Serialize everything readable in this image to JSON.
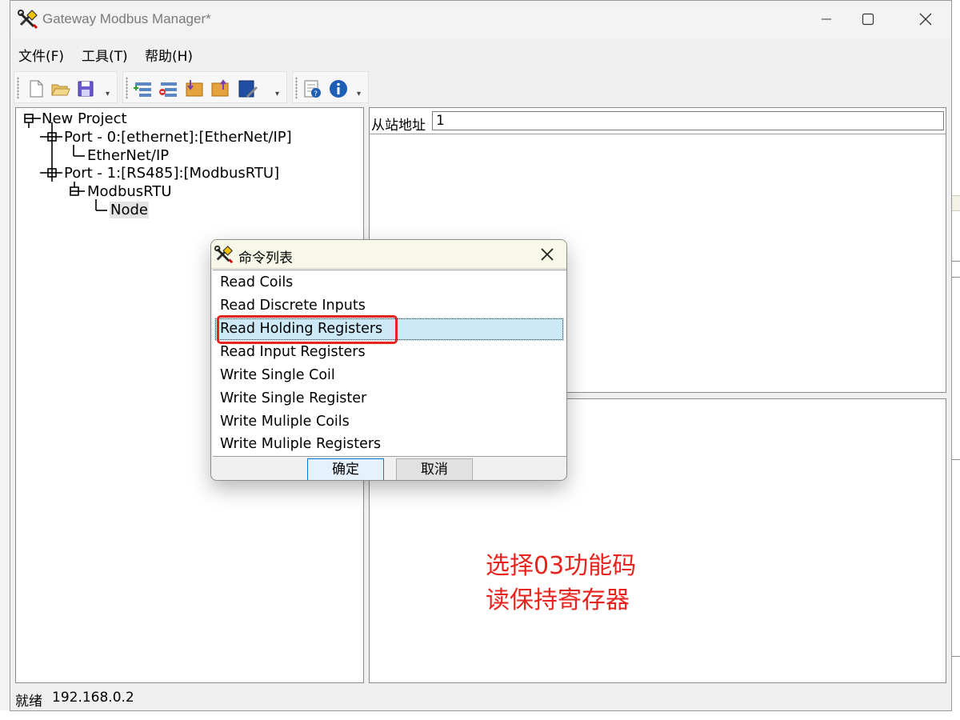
{
  "window": {
    "title": "Gateway Modbus Manager*",
    "minimize_label": "minimize",
    "maximize_label": "maximize",
    "close_label": "close"
  },
  "menu": [
    {
      "label": "文件(F)"
    },
    {
      "label": "工具(T)"
    },
    {
      "label": "帮助(H)"
    }
  ],
  "toolbar": {
    "icons": [
      "new-file-icon",
      "open-folder-icon",
      "save-icon",
      "add-node-icon",
      "delete-node-icon",
      "read-icon",
      "write-icon",
      "edit-icon",
      "help-doc-icon",
      "info-icon"
    ]
  },
  "tree": {
    "root": "New Project",
    "port0": "Port - 0:[ethernet]:[EtherNet/IP]",
    "port0_child": "EtherNet/IP",
    "port1": "Port - 1:[RS485]:[ModbusRTU]",
    "port1_child": "ModbusRTU",
    "node": "Node"
  },
  "details": {
    "slave_address_label": "从站地址",
    "slave_address_value": "1"
  },
  "annotation": {
    "line1": "选择03功能码",
    "line2": "读保持寄存器"
  },
  "statusbar": {
    "status": "就绪",
    "ip": "192.168.0.2"
  },
  "dialog": {
    "title": "命令列表",
    "commands": [
      "Read Coils",
      "Read Discrete Inputs",
      "Read Holding Registers",
      "Read Input Registers",
      "Write Single Coil",
      "Write Single Register",
      "Write Muliple Coils",
      "Write Muliple Registers"
    ],
    "selected_command": "Read Holding Registers",
    "ok_label": "确定",
    "cancel_label": "取消"
  },
  "colors": {
    "annotation_red": "#e8231e",
    "selection_blue": "#cde8f7",
    "dialog_title_bg": "#f8f8e8"
  }
}
